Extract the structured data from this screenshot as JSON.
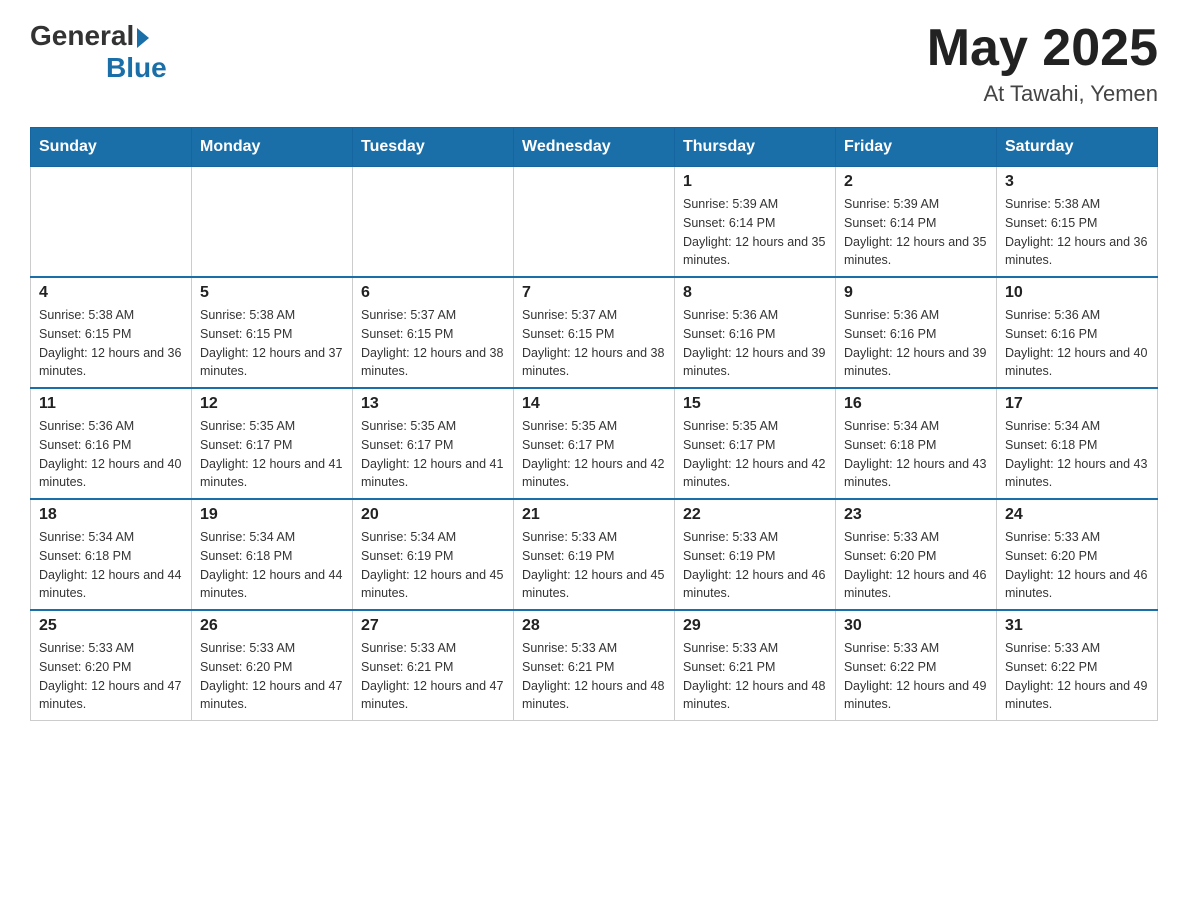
{
  "logo": {
    "general": "General",
    "blue": "Blue"
  },
  "header": {
    "month": "May 2025",
    "location": "At Tawahi, Yemen"
  },
  "days_of_week": [
    "Sunday",
    "Monday",
    "Tuesday",
    "Wednesday",
    "Thursday",
    "Friday",
    "Saturday"
  ],
  "weeks": [
    [
      {
        "day": "",
        "info": ""
      },
      {
        "day": "",
        "info": ""
      },
      {
        "day": "",
        "info": ""
      },
      {
        "day": "",
        "info": ""
      },
      {
        "day": "1",
        "sunrise": "Sunrise: 5:39 AM",
        "sunset": "Sunset: 6:14 PM",
        "daylight": "Daylight: 12 hours and 35 minutes."
      },
      {
        "day": "2",
        "sunrise": "Sunrise: 5:39 AM",
        "sunset": "Sunset: 6:14 PM",
        "daylight": "Daylight: 12 hours and 35 minutes."
      },
      {
        "day": "3",
        "sunrise": "Sunrise: 5:38 AM",
        "sunset": "Sunset: 6:15 PM",
        "daylight": "Daylight: 12 hours and 36 minutes."
      }
    ],
    [
      {
        "day": "4",
        "sunrise": "Sunrise: 5:38 AM",
        "sunset": "Sunset: 6:15 PM",
        "daylight": "Daylight: 12 hours and 36 minutes."
      },
      {
        "day": "5",
        "sunrise": "Sunrise: 5:38 AM",
        "sunset": "Sunset: 6:15 PM",
        "daylight": "Daylight: 12 hours and 37 minutes."
      },
      {
        "day": "6",
        "sunrise": "Sunrise: 5:37 AM",
        "sunset": "Sunset: 6:15 PM",
        "daylight": "Daylight: 12 hours and 38 minutes."
      },
      {
        "day": "7",
        "sunrise": "Sunrise: 5:37 AM",
        "sunset": "Sunset: 6:15 PM",
        "daylight": "Daylight: 12 hours and 38 minutes."
      },
      {
        "day": "8",
        "sunrise": "Sunrise: 5:36 AM",
        "sunset": "Sunset: 6:16 PM",
        "daylight": "Daylight: 12 hours and 39 minutes."
      },
      {
        "day": "9",
        "sunrise": "Sunrise: 5:36 AM",
        "sunset": "Sunset: 6:16 PM",
        "daylight": "Daylight: 12 hours and 39 minutes."
      },
      {
        "day": "10",
        "sunrise": "Sunrise: 5:36 AM",
        "sunset": "Sunset: 6:16 PM",
        "daylight": "Daylight: 12 hours and 40 minutes."
      }
    ],
    [
      {
        "day": "11",
        "sunrise": "Sunrise: 5:36 AM",
        "sunset": "Sunset: 6:16 PM",
        "daylight": "Daylight: 12 hours and 40 minutes."
      },
      {
        "day": "12",
        "sunrise": "Sunrise: 5:35 AM",
        "sunset": "Sunset: 6:17 PM",
        "daylight": "Daylight: 12 hours and 41 minutes."
      },
      {
        "day": "13",
        "sunrise": "Sunrise: 5:35 AM",
        "sunset": "Sunset: 6:17 PM",
        "daylight": "Daylight: 12 hours and 41 minutes."
      },
      {
        "day": "14",
        "sunrise": "Sunrise: 5:35 AM",
        "sunset": "Sunset: 6:17 PM",
        "daylight": "Daylight: 12 hours and 42 minutes."
      },
      {
        "day": "15",
        "sunrise": "Sunrise: 5:35 AM",
        "sunset": "Sunset: 6:17 PM",
        "daylight": "Daylight: 12 hours and 42 minutes."
      },
      {
        "day": "16",
        "sunrise": "Sunrise: 5:34 AM",
        "sunset": "Sunset: 6:18 PM",
        "daylight": "Daylight: 12 hours and 43 minutes."
      },
      {
        "day": "17",
        "sunrise": "Sunrise: 5:34 AM",
        "sunset": "Sunset: 6:18 PM",
        "daylight": "Daylight: 12 hours and 43 minutes."
      }
    ],
    [
      {
        "day": "18",
        "sunrise": "Sunrise: 5:34 AM",
        "sunset": "Sunset: 6:18 PM",
        "daylight": "Daylight: 12 hours and 44 minutes."
      },
      {
        "day": "19",
        "sunrise": "Sunrise: 5:34 AM",
        "sunset": "Sunset: 6:18 PM",
        "daylight": "Daylight: 12 hours and 44 minutes."
      },
      {
        "day": "20",
        "sunrise": "Sunrise: 5:34 AM",
        "sunset": "Sunset: 6:19 PM",
        "daylight": "Daylight: 12 hours and 45 minutes."
      },
      {
        "day": "21",
        "sunrise": "Sunrise: 5:33 AM",
        "sunset": "Sunset: 6:19 PM",
        "daylight": "Daylight: 12 hours and 45 minutes."
      },
      {
        "day": "22",
        "sunrise": "Sunrise: 5:33 AM",
        "sunset": "Sunset: 6:19 PM",
        "daylight": "Daylight: 12 hours and 46 minutes."
      },
      {
        "day": "23",
        "sunrise": "Sunrise: 5:33 AM",
        "sunset": "Sunset: 6:20 PM",
        "daylight": "Daylight: 12 hours and 46 minutes."
      },
      {
        "day": "24",
        "sunrise": "Sunrise: 5:33 AM",
        "sunset": "Sunset: 6:20 PM",
        "daylight": "Daylight: 12 hours and 46 minutes."
      }
    ],
    [
      {
        "day": "25",
        "sunrise": "Sunrise: 5:33 AM",
        "sunset": "Sunset: 6:20 PM",
        "daylight": "Daylight: 12 hours and 47 minutes."
      },
      {
        "day": "26",
        "sunrise": "Sunrise: 5:33 AM",
        "sunset": "Sunset: 6:20 PM",
        "daylight": "Daylight: 12 hours and 47 minutes."
      },
      {
        "day": "27",
        "sunrise": "Sunrise: 5:33 AM",
        "sunset": "Sunset: 6:21 PM",
        "daylight": "Daylight: 12 hours and 47 minutes."
      },
      {
        "day": "28",
        "sunrise": "Sunrise: 5:33 AM",
        "sunset": "Sunset: 6:21 PM",
        "daylight": "Daylight: 12 hours and 48 minutes."
      },
      {
        "day": "29",
        "sunrise": "Sunrise: 5:33 AM",
        "sunset": "Sunset: 6:21 PM",
        "daylight": "Daylight: 12 hours and 48 minutes."
      },
      {
        "day": "30",
        "sunrise": "Sunrise: 5:33 AM",
        "sunset": "Sunset: 6:22 PM",
        "daylight": "Daylight: 12 hours and 49 minutes."
      },
      {
        "day": "31",
        "sunrise": "Sunrise: 5:33 AM",
        "sunset": "Sunset: 6:22 PM",
        "daylight": "Daylight: 12 hours and 49 minutes."
      }
    ]
  ]
}
